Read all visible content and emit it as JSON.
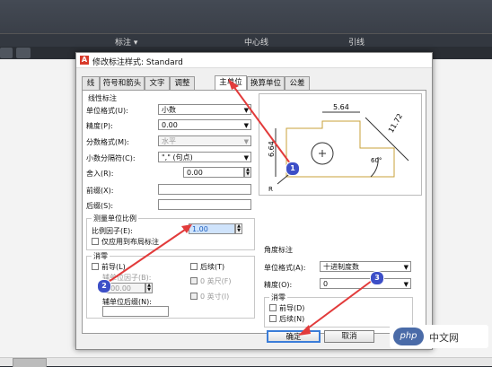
{
  "ribbon": {
    "panels": [
      "标注 ▾",
      "中心线",
      "引线"
    ]
  },
  "dialog": {
    "title": "修改标注样式: Standard",
    "tabs": [
      "线",
      "符号和箭头",
      "文字",
      "调整",
      "主单位",
      "换算单位",
      "公差"
    ],
    "active_tab": "主单位",
    "linear": {
      "title": "线性标注",
      "unit_format_label": "单位格式(U):",
      "unit_format_value": "小数",
      "precision_label": "精度(P):",
      "precision_value": "0.00",
      "fraction_label": "分数格式(M):",
      "fraction_value": "水平",
      "decimal_sep_label": "小数分隔符(C):",
      "decimal_sep_value": "\",\" (句点)",
      "roundoff_label": "舍入(R):",
      "roundoff_value": "0.00",
      "prefix_label": "前缀(X):",
      "prefix_value": "",
      "suffix_label": "后缀(S):",
      "suffix_value": ""
    },
    "scale": {
      "title": "测量单位比例",
      "factor_label": "比例因子(E):",
      "factor_value": "1.00",
      "layout_only_label": "仅应用到布局标注"
    },
    "zero_left": {
      "title": "消零",
      "leading_label": "前导(L)",
      "trailing_label": "后续(T)",
      "sub_factor_label": "辅单位因子(B):",
      "sub_factor_value": "100.00",
      "feet_label": "0 英尺(F)",
      "inches_label": "0 英寸(I)",
      "sub_suffix_label": "辅单位后缀(N):",
      "sub_suffix_value": ""
    },
    "angular": {
      "title": "角度标注",
      "unit_format_label": "单位格式(A):",
      "unit_format_value": "十进制度数",
      "precision_label": "精度(O):",
      "precision_value": "0"
    },
    "zero_right": {
      "title": "消零",
      "leading_label": "前导(D)",
      "trailing_label": "后续(N)"
    },
    "preview": {
      "dim_top": "5.64",
      "dim_left": "6.64",
      "dim_right": "11.72",
      "angle": "60°",
      "radius": "R"
    },
    "buttons": {
      "ok": "确定",
      "cancel": "取消"
    }
  },
  "annotations": [
    "1",
    "2",
    "3"
  ],
  "watermark": {
    "logo": "php",
    "text": "中文网"
  },
  "colors": {
    "accent": "#3b7dd8",
    "arrow": "#e23b3b",
    "badge": "#3d4fc7"
  }
}
